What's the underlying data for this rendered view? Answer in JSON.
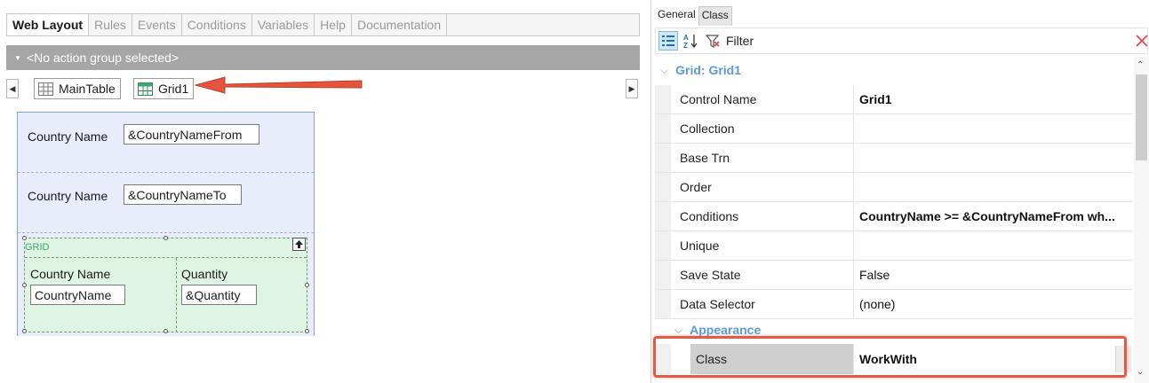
{
  "designer": {
    "tabs": [
      {
        "label": "Web Layout",
        "active": true
      },
      {
        "label": "Rules"
      },
      {
        "label": "Events"
      },
      {
        "label": "Conditions"
      },
      {
        "label": "Variables"
      },
      {
        "label": "Help"
      },
      {
        "label": "Documentation"
      }
    ],
    "action_group": "<No action group selected>",
    "breadcrumbs": [
      {
        "label": "MainTable",
        "icon": "table-icon"
      },
      {
        "label": "Grid1",
        "icon": "grid-icon"
      }
    ],
    "form": {
      "row1": {
        "label": "Country Name",
        "value": "&CountryNameFrom"
      },
      "row2": {
        "label": "Country Name",
        "value": "&CountryNameTo"
      },
      "grid": {
        "caption": "GRID",
        "col1_header": "Country Name",
        "col1_value": "CountryName",
        "col2_header": "Quantity",
        "col2_value": "&Quantity"
      }
    }
  },
  "properties": {
    "tabs": [
      {
        "label": "General",
        "active": false
      },
      {
        "label": "Class",
        "active": true
      }
    ],
    "toolbar": {
      "filter_label": "Filter",
      "filter_value": ""
    },
    "category_grid": "Grid: Grid1",
    "category_appearance": "Appearance",
    "rows": [
      {
        "name": "Control Name",
        "value": "Grid1",
        "bold": true
      },
      {
        "name": "Collection",
        "value": ""
      },
      {
        "name": "Base Trn",
        "value": ""
      },
      {
        "name": "Order",
        "value": ""
      },
      {
        "name": "Conditions",
        "value": "CountryName >= &CountryNameFrom wh...",
        "bold": true
      },
      {
        "name": "Unique",
        "value": ""
      },
      {
        "name": "Save State",
        "value": "False"
      },
      {
        "name": "Data Selector",
        "value": "(none)"
      }
    ],
    "class_row": {
      "name": "Class",
      "value": "WorkWith"
    }
  },
  "colors": {
    "accent_red": "#e45a44",
    "category_blue": "#5b9bd5",
    "form_band": "#e9ecfb",
    "grid_green": "#dff5e3"
  }
}
